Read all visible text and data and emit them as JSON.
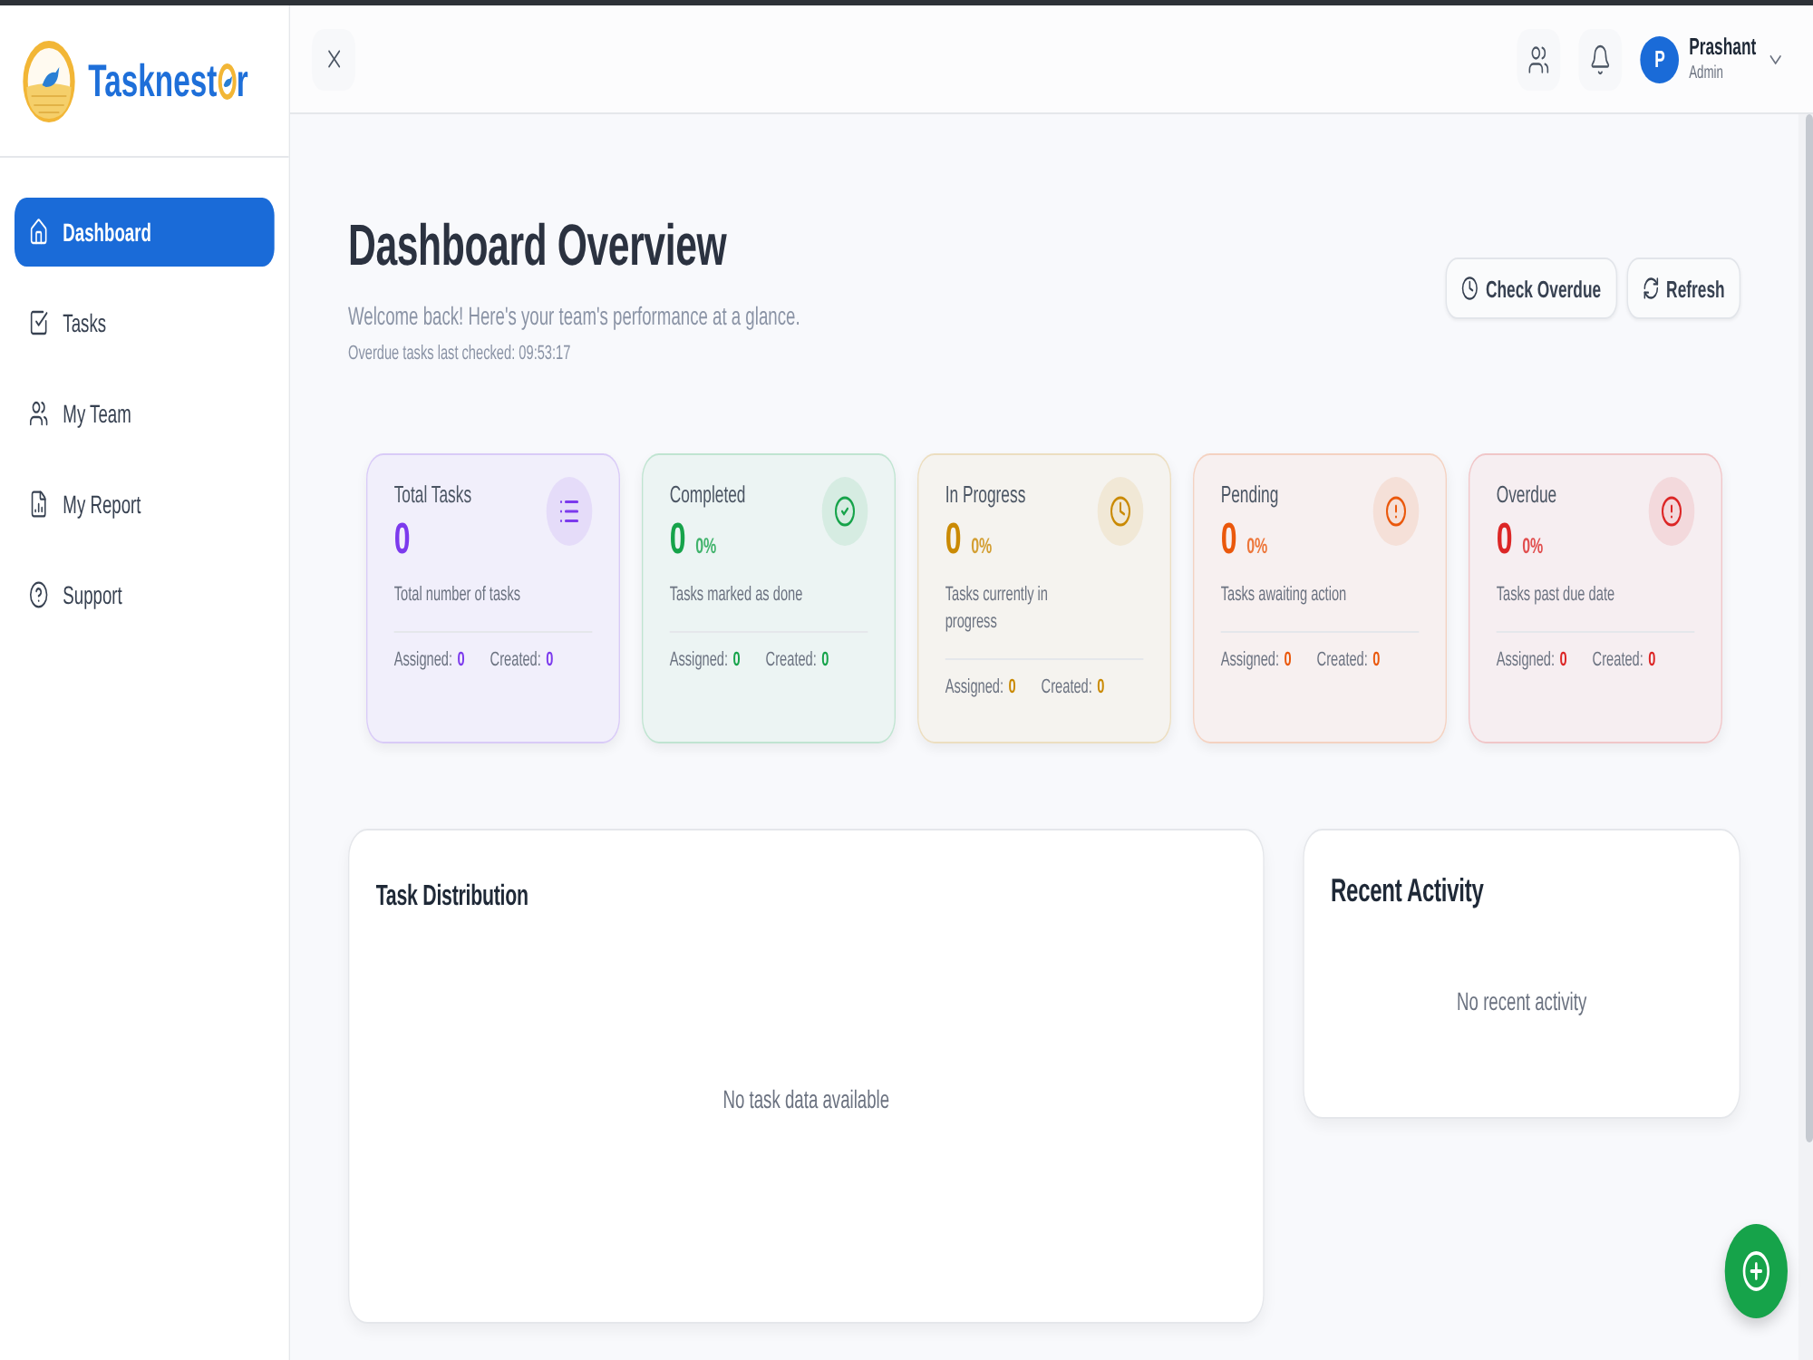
{
  "sidebar": {
    "logo": {
      "name_start": "Tasknest",
      "name_end": "r"
    },
    "items": [
      {
        "label": "Dashboard",
        "kind": "home",
        "selected": true
      },
      {
        "label": "Tasks",
        "kind": "tasks",
        "selected": false
      },
      {
        "label": "My Team",
        "kind": "team",
        "selected": false
      },
      {
        "label": "My Report",
        "kind": "report",
        "selected": false
      },
      {
        "label": "Support",
        "kind": "support",
        "selected": false
      }
    ]
  },
  "header": {
    "user": {
      "initial": "P",
      "name": "Prashant",
      "role": "Admin"
    }
  },
  "page": {
    "title": "Dashboard Overview",
    "subtitle": "Welcome back! Here's your team's performance at a glance.",
    "last_checked": "Overdue tasks last checked: 09:53:17",
    "buttons": [
      {
        "label": "Check Overdue",
        "kind": "clock"
      },
      {
        "label": "Refresh",
        "kind": "refresh"
      }
    ]
  },
  "stats": [
    {
      "kind": "total",
      "title": "Total Tasks",
      "value": "0",
      "description": "Total number of tasks",
      "assigned_label": "Assigned:",
      "assigned": "0",
      "created_label": "Created:",
      "created": "0",
      "color": "#7c3aed"
    },
    {
      "kind": "completed",
      "title": "Completed",
      "value": "0",
      "percent": "0%",
      "description": "Tasks marked as done",
      "assigned_label": "Assigned:",
      "assigned": "0",
      "created_label": "Created:",
      "created": "0",
      "color": "#16a34a"
    },
    {
      "kind": "in_progress",
      "title": "In Progress",
      "value": "0",
      "percent": "0%",
      "description": "Tasks currently in progress",
      "assigned_label": "Assigned:",
      "assigned": "0",
      "created_label": "Created:",
      "created": "0",
      "color": "#ca8a04"
    },
    {
      "kind": "pending",
      "title": "Pending",
      "value": "0",
      "percent": "0%",
      "description": "Tasks awaiting action",
      "assigned_label": "Assigned:",
      "assigned": "0",
      "created_label": "Created:",
      "created": "0",
      "color": "#ea580c"
    },
    {
      "kind": "overdue",
      "title": "Overdue",
      "value": "0",
      "percent": "0%",
      "description": "Tasks past due date",
      "assigned_label": "Assigned:",
      "assigned": "0",
      "created_label": "Created:",
      "created": "0",
      "color": "#dc2626"
    }
  ],
  "task_distribution": {
    "title": "Task Distribution",
    "empty_text": "No task data available"
  },
  "recent_activity": {
    "title": "Recent Activity",
    "empty_text": "No recent activity"
  }
}
